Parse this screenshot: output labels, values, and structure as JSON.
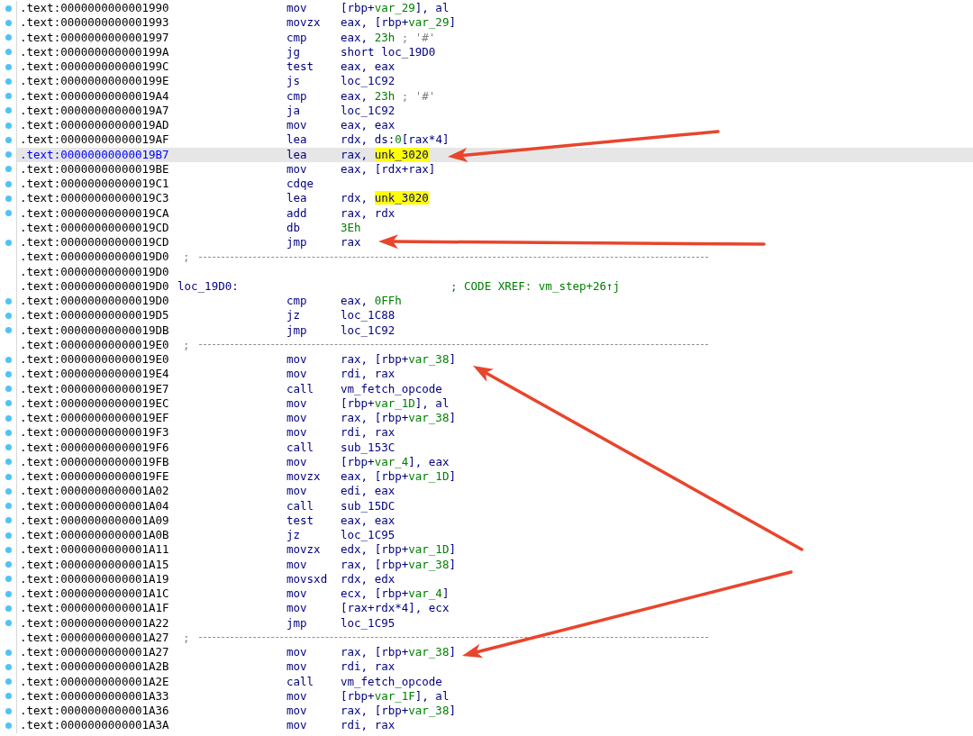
{
  "listing": [
    {
      "kind": "instruction",
      "address": ".text:0000000000001990",
      "dot": true,
      "selected": false,
      "mnemonic": "mov",
      "operand": [
        {
          "text": "[rbp+",
          "kind": "plain"
        },
        {
          "text": "var_29",
          "kind": "name"
        },
        {
          "text": "], al",
          "kind": "plain"
        }
      ]
    },
    {
      "kind": "instruction",
      "address": ".text:0000000000001993",
      "dot": true,
      "selected": false,
      "mnemonic": "movzx",
      "operand": [
        {
          "text": "eax, [rbp+",
          "kind": "plain"
        },
        {
          "text": "var_29",
          "kind": "name"
        },
        {
          "text": "]",
          "kind": "plain"
        }
      ]
    },
    {
      "kind": "instruction",
      "address": ".text:0000000000001997",
      "dot": true,
      "selected": false,
      "mnemonic": "cmp",
      "operand": [
        {
          "text": "eax, ",
          "kind": "plain"
        },
        {
          "text": "23h",
          "kind": "number"
        },
        {
          "text": " ; '#'",
          "kind": "comment"
        }
      ]
    },
    {
      "kind": "instruction",
      "address": ".text:000000000000199A",
      "dot": true,
      "selected": false,
      "mnemonic": "jg",
      "operand": [
        {
          "text": "short loc_19D0",
          "kind": "plain"
        }
      ]
    },
    {
      "kind": "instruction",
      "address": ".text:000000000000199C",
      "dot": true,
      "selected": false,
      "mnemonic": "test",
      "operand": [
        {
          "text": "eax, eax",
          "kind": "plain"
        }
      ]
    },
    {
      "kind": "instruction",
      "address": ".text:000000000000199E",
      "dot": true,
      "selected": false,
      "mnemonic": "js",
      "operand": [
        {
          "text": "loc_1C92",
          "kind": "plain"
        }
      ]
    },
    {
      "kind": "instruction",
      "address": ".text:00000000000019A4",
      "dot": true,
      "selected": false,
      "mnemonic": "cmp",
      "operand": [
        {
          "text": "eax, ",
          "kind": "plain"
        },
        {
          "text": "23h",
          "kind": "number"
        },
        {
          "text": " ; '#'",
          "kind": "comment"
        }
      ]
    },
    {
      "kind": "instruction",
      "address": ".text:00000000000019A7",
      "dot": true,
      "selected": false,
      "mnemonic": "ja",
      "operand": [
        {
          "text": "loc_1C92",
          "kind": "plain"
        }
      ]
    },
    {
      "kind": "instruction",
      "address": ".text:00000000000019AD",
      "dot": true,
      "selected": false,
      "mnemonic": "mov",
      "operand": [
        {
          "text": "eax, eax",
          "kind": "plain"
        }
      ]
    },
    {
      "kind": "instruction",
      "address": ".text:00000000000019AF",
      "dot": true,
      "selected": false,
      "mnemonic": "lea",
      "operand": [
        {
          "text": "rdx, ds:",
          "kind": "plain"
        },
        {
          "text": "0",
          "kind": "number"
        },
        {
          "text": "[rax*4]",
          "kind": "plain"
        }
      ]
    },
    {
      "kind": "instruction",
      "address": ".text:00000000000019B7",
      "dot": true,
      "selected": true,
      "mnemonic": "lea",
      "operand": [
        {
          "text": "rax, ",
          "kind": "plain"
        },
        {
          "text": "unk_3020",
          "kind": "highlight"
        }
      ]
    },
    {
      "kind": "instruction",
      "address": ".text:00000000000019BE",
      "dot": true,
      "selected": false,
      "mnemonic": "mov",
      "operand": [
        {
          "text": "eax, [rdx+rax]",
          "kind": "plain"
        }
      ]
    },
    {
      "kind": "instruction",
      "address": ".text:00000000000019C1",
      "dot": true,
      "selected": false,
      "mnemonic": "cdqe"
    },
    {
      "kind": "instruction",
      "address": ".text:00000000000019C3",
      "dot": true,
      "selected": false,
      "mnemonic": "lea",
      "operand": [
        {
          "text": "rdx, ",
          "kind": "plain"
        },
        {
          "text": "unk_3020",
          "kind": "highlight"
        }
      ]
    },
    {
      "kind": "instruction",
      "address": ".text:00000000000019CA",
      "dot": true,
      "selected": false,
      "mnemonic": "add",
      "operand": [
        {
          "text": "rax, rdx",
          "kind": "plain"
        }
      ]
    },
    {
      "kind": "instruction",
      "address": ".text:00000000000019CD",
      "dot": false,
      "selected": false,
      "mnemonic": "db",
      "operand": [
        {
          "text": "3Eh",
          "kind": "number"
        }
      ]
    },
    {
      "kind": "instruction",
      "address": ".text:00000000000019CD",
      "dot": true,
      "selected": false,
      "mnemonic": "jmp",
      "operand": [
        {
          "text": "rax",
          "kind": "plain"
        }
      ]
    },
    {
      "kind": "separator",
      "address": ".text:00000000000019D0",
      "dot": false,
      "selected": false,
      "comment": ";"
    },
    {
      "kind": "blank",
      "address": ".text:00000000000019D0",
      "dot": false,
      "selected": false
    },
    {
      "kind": "label",
      "address": ".text:00000000000019D0",
      "dot": false,
      "selected": false,
      "label": "loc_19D0:",
      "comment": "; CODE XREF: vm_step+26↑j"
    },
    {
      "kind": "instruction",
      "address": ".text:00000000000019D0",
      "dot": true,
      "selected": false,
      "mnemonic": "cmp",
      "operand": [
        {
          "text": "eax, ",
          "kind": "plain"
        },
        {
          "text": "0FFh",
          "kind": "number"
        }
      ]
    },
    {
      "kind": "instruction",
      "address": ".text:00000000000019D5",
      "dot": true,
      "selected": false,
      "mnemonic": "jz",
      "operand": [
        {
          "text": "loc_1C88",
          "kind": "plain"
        }
      ]
    },
    {
      "kind": "instruction",
      "address": ".text:00000000000019DB",
      "dot": true,
      "selected": false,
      "mnemonic": "jmp",
      "operand": [
        {
          "text": "loc_1C92",
          "kind": "plain"
        }
      ]
    },
    {
      "kind": "separator",
      "address": ".text:00000000000019E0",
      "dot": false,
      "selected": false,
      "comment": ";"
    },
    {
      "kind": "instruction",
      "address": ".text:00000000000019E0",
      "dot": true,
      "selected": false,
      "mnemonic": "mov",
      "operand": [
        {
          "text": "rax, [rbp+",
          "kind": "plain"
        },
        {
          "text": "var_38",
          "kind": "name"
        },
        {
          "text": "]",
          "kind": "plain"
        }
      ]
    },
    {
      "kind": "instruction",
      "address": ".text:00000000000019E4",
      "dot": true,
      "selected": false,
      "mnemonic": "mov",
      "operand": [
        {
          "text": "rdi, rax",
          "kind": "plain"
        }
      ]
    },
    {
      "kind": "instruction",
      "address": ".text:00000000000019E7",
      "dot": true,
      "selected": false,
      "mnemonic": "call",
      "operand": [
        {
          "text": "vm_fetch_opcode",
          "kind": "plain"
        }
      ]
    },
    {
      "kind": "instruction",
      "address": ".text:00000000000019EC",
      "dot": true,
      "selected": false,
      "mnemonic": "mov",
      "operand": [
        {
          "text": "[rbp+",
          "kind": "plain"
        },
        {
          "text": "var_1D",
          "kind": "name"
        },
        {
          "text": "], al",
          "kind": "plain"
        }
      ]
    },
    {
      "kind": "instruction",
      "address": ".text:00000000000019EF",
      "dot": true,
      "selected": false,
      "mnemonic": "mov",
      "operand": [
        {
          "text": "rax, [rbp+",
          "kind": "plain"
        },
        {
          "text": "var_38",
          "kind": "name"
        },
        {
          "text": "]",
          "kind": "plain"
        }
      ]
    },
    {
      "kind": "instruction",
      "address": ".text:00000000000019F3",
      "dot": true,
      "selected": false,
      "mnemonic": "mov",
      "operand": [
        {
          "text": "rdi, rax",
          "kind": "plain"
        }
      ]
    },
    {
      "kind": "instruction",
      "address": ".text:00000000000019F6",
      "dot": true,
      "selected": false,
      "mnemonic": "call",
      "operand": [
        {
          "text": "sub_153C",
          "kind": "plain"
        }
      ]
    },
    {
      "kind": "instruction",
      "address": ".text:00000000000019FB",
      "dot": true,
      "selected": false,
      "mnemonic": "mov",
      "operand": [
        {
          "text": "[rbp+",
          "kind": "plain"
        },
        {
          "text": "var_4",
          "kind": "name"
        },
        {
          "text": "], eax",
          "kind": "plain"
        }
      ]
    },
    {
      "kind": "instruction",
      "address": ".text:00000000000019FE",
      "dot": true,
      "selected": false,
      "mnemonic": "movzx",
      "operand": [
        {
          "text": "eax, [rbp+",
          "kind": "plain"
        },
        {
          "text": "var_1D",
          "kind": "name"
        },
        {
          "text": "]",
          "kind": "plain"
        }
      ]
    },
    {
      "kind": "instruction",
      "address": ".text:0000000000001A02",
      "dot": true,
      "selected": false,
      "mnemonic": "mov",
      "operand": [
        {
          "text": "edi, eax",
          "kind": "plain"
        }
      ]
    },
    {
      "kind": "instruction",
      "address": ".text:0000000000001A04",
      "dot": true,
      "selected": false,
      "mnemonic": "call",
      "operand": [
        {
          "text": "sub_15DC",
          "kind": "plain"
        }
      ]
    },
    {
      "kind": "instruction",
      "address": ".text:0000000000001A09",
      "dot": true,
      "selected": false,
      "mnemonic": "test",
      "operand": [
        {
          "text": "eax, eax",
          "kind": "plain"
        }
      ]
    },
    {
      "kind": "instruction",
      "address": ".text:0000000000001A0B",
      "dot": true,
      "selected": false,
      "mnemonic": "jz",
      "operand": [
        {
          "text": "loc_1C95",
          "kind": "plain"
        }
      ]
    },
    {
      "kind": "instruction",
      "address": ".text:0000000000001A11",
      "dot": true,
      "selected": false,
      "mnemonic": "movzx",
      "operand": [
        {
          "text": "edx, [rbp+",
          "kind": "plain"
        },
        {
          "text": "var_1D",
          "kind": "name"
        },
        {
          "text": "]",
          "kind": "plain"
        }
      ]
    },
    {
      "kind": "instruction",
      "address": ".text:0000000000001A15",
      "dot": true,
      "selected": false,
      "mnemonic": "mov",
      "operand": [
        {
          "text": "rax, [rbp+",
          "kind": "plain"
        },
        {
          "text": "var_38",
          "kind": "name"
        },
        {
          "text": "]",
          "kind": "plain"
        }
      ]
    },
    {
      "kind": "instruction",
      "address": ".text:0000000000001A19",
      "dot": true,
      "selected": false,
      "mnemonic": "movsxd",
      "operand": [
        {
          "text": "rdx, edx",
          "kind": "plain"
        }
      ]
    },
    {
      "kind": "instruction",
      "address": ".text:0000000000001A1C",
      "dot": true,
      "selected": false,
      "mnemonic": "mov",
      "operand": [
        {
          "text": "ecx, [rbp+",
          "kind": "plain"
        },
        {
          "text": "var_4",
          "kind": "name"
        },
        {
          "text": "]",
          "kind": "plain"
        }
      ]
    },
    {
      "kind": "instruction",
      "address": ".text:0000000000001A1F",
      "dot": true,
      "selected": false,
      "mnemonic": "mov",
      "operand": [
        {
          "text": "[rax+rdx*4], ecx",
          "kind": "plain"
        }
      ]
    },
    {
      "kind": "instruction",
      "address": ".text:0000000000001A22",
      "dot": true,
      "selected": false,
      "mnemonic": "jmp",
      "operand": [
        {
          "text": "loc_1C95",
          "kind": "plain"
        }
      ]
    },
    {
      "kind": "separator",
      "address": ".text:0000000000001A27",
      "dot": false,
      "selected": false,
      "comment": ";"
    },
    {
      "kind": "instruction",
      "address": ".text:0000000000001A27",
      "dot": true,
      "selected": false,
      "mnemonic": "mov",
      "operand": [
        {
          "text": "rax, [rbp+",
          "kind": "plain"
        },
        {
          "text": "var_38",
          "kind": "name"
        },
        {
          "text": "]",
          "kind": "plain"
        }
      ]
    },
    {
      "kind": "instruction",
      "address": ".text:0000000000001A2B",
      "dot": true,
      "selected": false,
      "mnemonic": "mov",
      "operand": [
        {
          "text": "rdi, rax",
          "kind": "plain"
        }
      ]
    },
    {
      "kind": "instruction",
      "address": ".text:0000000000001A2E",
      "dot": true,
      "selected": false,
      "mnemonic": "call",
      "operand": [
        {
          "text": "vm_fetch_opcode",
          "kind": "plain"
        }
      ]
    },
    {
      "kind": "instruction",
      "address": ".text:0000000000001A33",
      "dot": true,
      "selected": false,
      "mnemonic": "mov",
      "operand": [
        {
          "text": "[rbp+",
          "kind": "plain"
        },
        {
          "text": "var_1F",
          "kind": "name"
        },
        {
          "text": "], al",
          "kind": "plain"
        }
      ]
    },
    {
      "kind": "instruction",
      "address": ".text:0000000000001A36",
      "dot": true,
      "selected": false,
      "mnemonic": "mov",
      "operand": [
        {
          "text": "rax, [rbp+",
          "kind": "plain"
        },
        {
          "text": "var_38",
          "kind": "name"
        },
        {
          "text": "]",
          "kind": "plain"
        }
      ]
    },
    {
      "kind": "instruction",
      "address": ".text:0000000000001A3A",
      "dot": true,
      "selected": false,
      "mnemonic": "mov",
      "operand": [
        {
          "text": "rdi, rax",
          "kind": "plain"
        }
      ]
    }
  ]
}
